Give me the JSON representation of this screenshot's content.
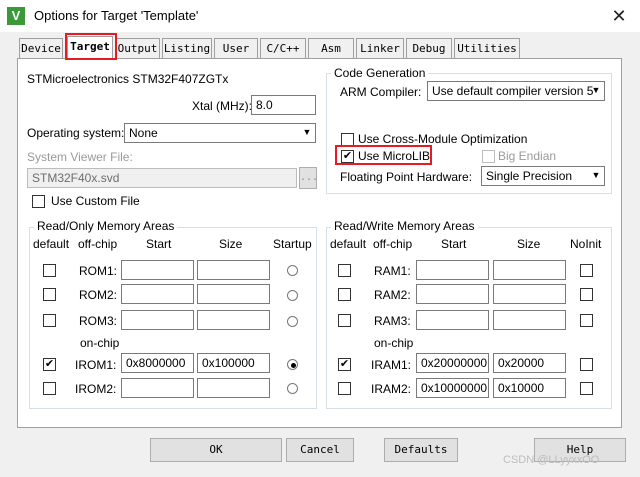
{
  "window": {
    "title": "Options for Target 'Template'",
    "icon_letter": "V",
    "close": "✕"
  },
  "tabs": [
    "Device",
    "Target",
    "Output",
    "Listing",
    "User",
    "C/C++",
    "Asm",
    "Linker",
    "Debug",
    "Utilities"
  ],
  "target": {
    "device": "STMicroelectronics STM32F407ZGTx",
    "xtal_label": "Xtal (MHz):",
    "xtal_value": "8.0",
    "os_label": "Operating system:",
    "os_value": "None",
    "svd_label": "System Viewer File:",
    "svd_value": "STM32F40x.svd",
    "svd_browse": "...",
    "use_custom_file": "Use Custom File"
  },
  "code_generation": {
    "title": "Code Generation",
    "compiler_label": "ARM Compiler:",
    "compiler_value": "Use default compiler version 5",
    "cross_module": "Use Cross-Module Optimization",
    "microlib": "Use MicroLIB",
    "big_endian": "Big Endian",
    "fp_label": "Floating Point Hardware:",
    "fp_value": "Single Precision"
  },
  "ro_memory": {
    "title": "Read/Only Memory Areas",
    "headers": {
      "default": "default",
      "offchip": "off-chip",
      "start": "Start",
      "size": "Size",
      "startup": "Startup"
    },
    "onchip_label": "on-chip",
    "rows": [
      {
        "name": "ROM1:",
        "start": "",
        "size": ""
      },
      {
        "name": "ROM2:",
        "start": "",
        "size": ""
      },
      {
        "name": "ROM3:",
        "start": "",
        "size": ""
      },
      {
        "name": "IROM1:",
        "start": "0x8000000",
        "size": "0x100000"
      },
      {
        "name": "IROM2:",
        "start": "",
        "size": ""
      }
    ]
  },
  "rw_memory": {
    "title": "Read/Write Memory Areas",
    "headers": {
      "default": "default",
      "offchip": "off-chip",
      "start": "Start",
      "size": "Size",
      "noinit": "NoInit"
    },
    "onchip_label": "on-chip",
    "rows": [
      {
        "name": "RAM1:",
        "start": "",
        "size": ""
      },
      {
        "name": "RAM2:",
        "start": "",
        "size": ""
      },
      {
        "name": "RAM3:",
        "start": "",
        "size": ""
      },
      {
        "name": "IRAM1:",
        "start": "0x20000000",
        "size": "0x20000"
      },
      {
        "name": "IRAM2:",
        "start": "0x10000000",
        "size": "0x10000"
      }
    ]
  },
  "buttons": {
    "ok": "OK",
    "cancel": "Cancel",
    "defaults": "Defaults",
    "help": "Help"
  },
  "watermark": "CSDN @LLyyxxOO"
}
